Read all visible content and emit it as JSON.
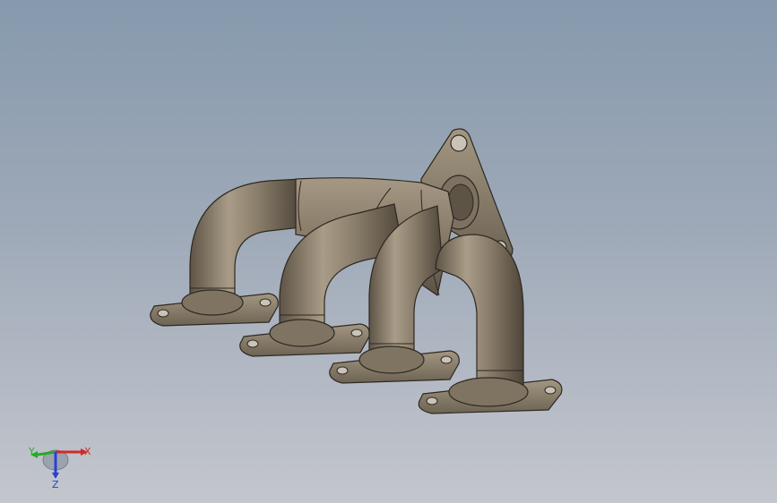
{
  "viewport": {
    "background_top": "#8699ad",
    "background_bottom": "#c3c6cc",
    "model_color": "#8b7f6c",
    "edge_color": "#2e2820"
  },
  "triad": {
    "x_label": "X",
    "y_label": "Y",
    "z_label": "Z",
    "x_color": "#d42a2a",
    "y_color": "#2aa82a",
    "z_color": "#2a3fd4"
  }
}
